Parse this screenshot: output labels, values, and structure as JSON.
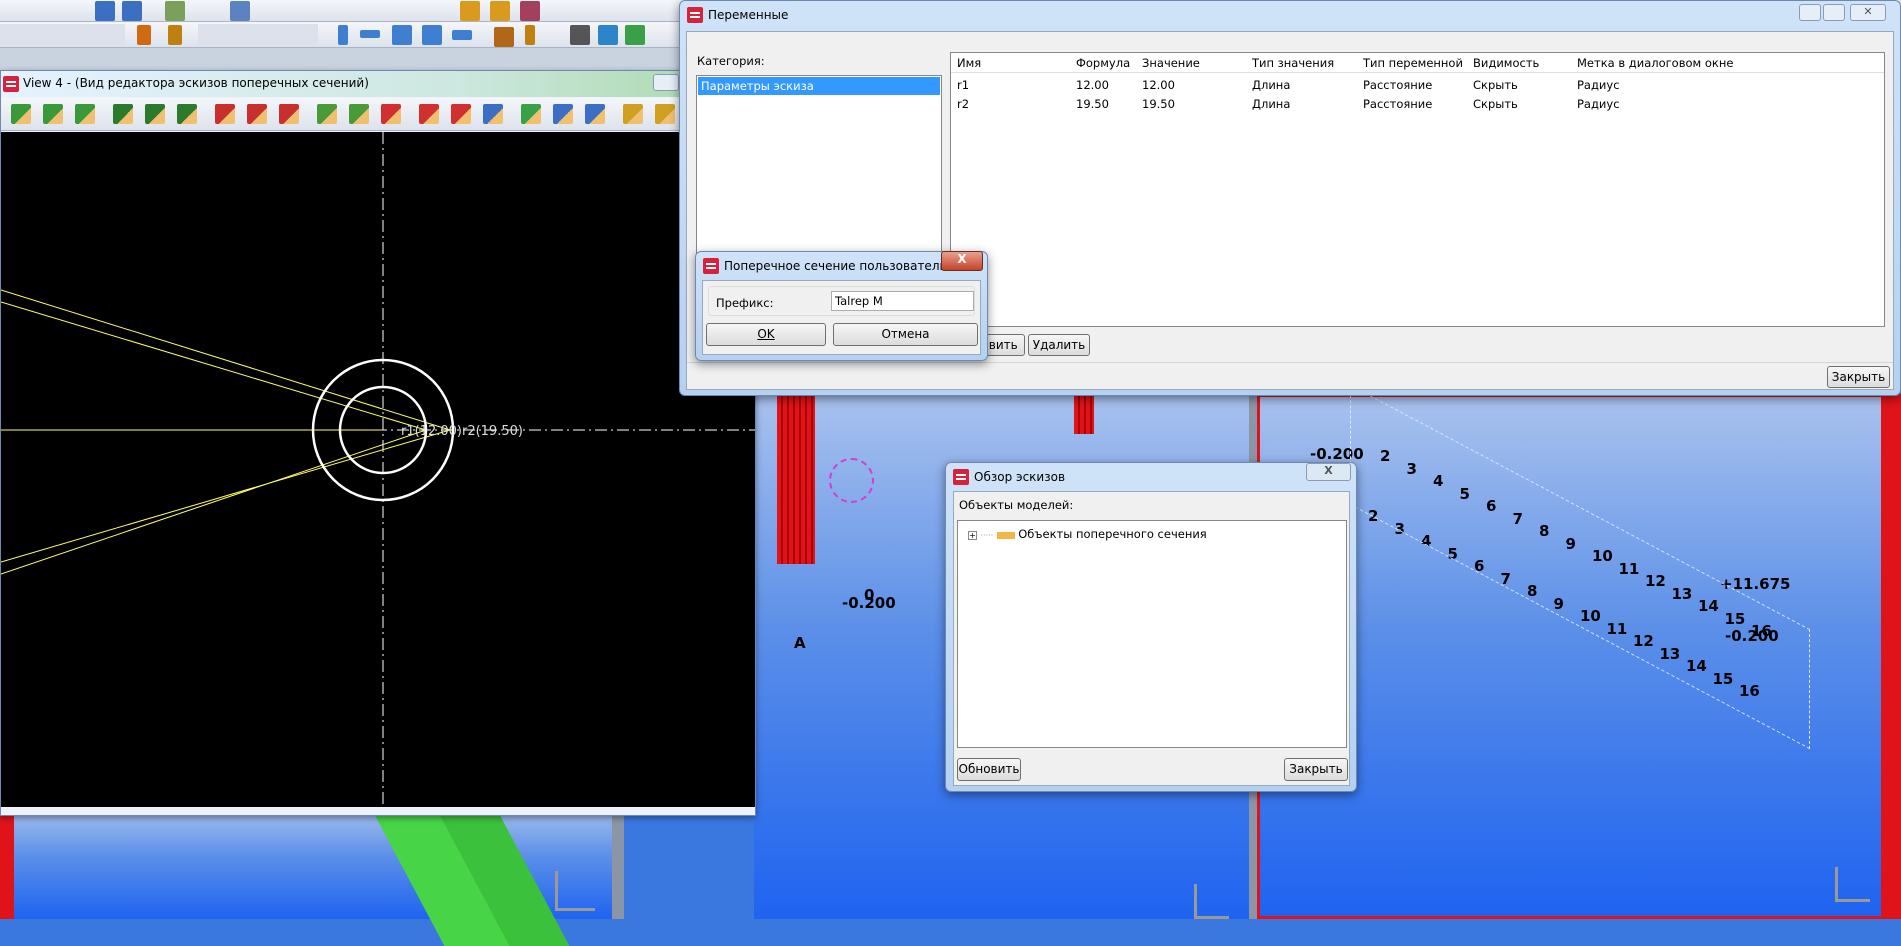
{
  "sketch_view": {
    "title": "View 4 - (Вид редактора эскизов поперечных сечений)",
    "dimension_label": "r1(12.00)r2(19.50)"
  },
  "model_labels": {
    "elevation_left": "-0.200",
    "zero_left": "0",
    "axis_a": "A",
    "elevation_right_top": "-0.200",
    "elevation_right_bottom": "-0.200",
    "elevation_right_end": "+11.675",
    "grid_numbers": [
      "2",
      "3",
      "4",
      "5",
      "6",
      "7",
      "8",
      "9",
      "10",
      "11",
      "12",
      "13",
      "14",
      "15",
      "16"
    ]
  },
  "variables_dialog": {
    "title": "Переменные",
    "category_label": "Категория:",
    "categories": [
      "Параметры эскиза"
    ],
    "columns": [
      "Имя",
      "Формула",
      "Значение",
      "Тип значения",
      "Тип переменной",
      "Видимость",
      "Метка в диалоговом окне"
    ],
    "rows": [
      [
        "r1",
        "12.00",
        "12.00",
        "Длина",
        "Расстояние",
        "Скрыть",
        "Радиус"
      ],
      [
        "r2",
        "19.50",
        "19.50",
        "Длина",
        "Расстояние",
        "Скрыть",
        "Радиус"
      ]
    ],
    "add_label": "Добавить",
    "delete_label": "Удалить",
    "close_label": "Закрыть"
  },
  "prefix_dialog": {
    "title": "Поперечное сечение пользовательс...",
    "prefix_label": "Префикс:",
    "prefix_value": "Talrep M",
    "ok_label": "OK",
    "cancel_label": "Отмена",
    "close_glyph": "X"
  },
  "sketch_browser": {
    "title": "Обзор эскизов",
    "objects_label": "Объекты моделей:",
    "tree_items": [
      "Объекты поперечного сечения"
    ],
    "refresh_label": "Обновить",
    "close_label": "Закрыть",
    "close_glyph": "X"
  },
  "colors": {
    "sketch_bg": "#000000",
    "sketch_circle": "#ffffff",
    "sketch_lines": "#ffff66",
    "view_bg": "#3a78e0",
    "selection": "#3399ff",
    "red_frame": "#e0131b"
  }
}
